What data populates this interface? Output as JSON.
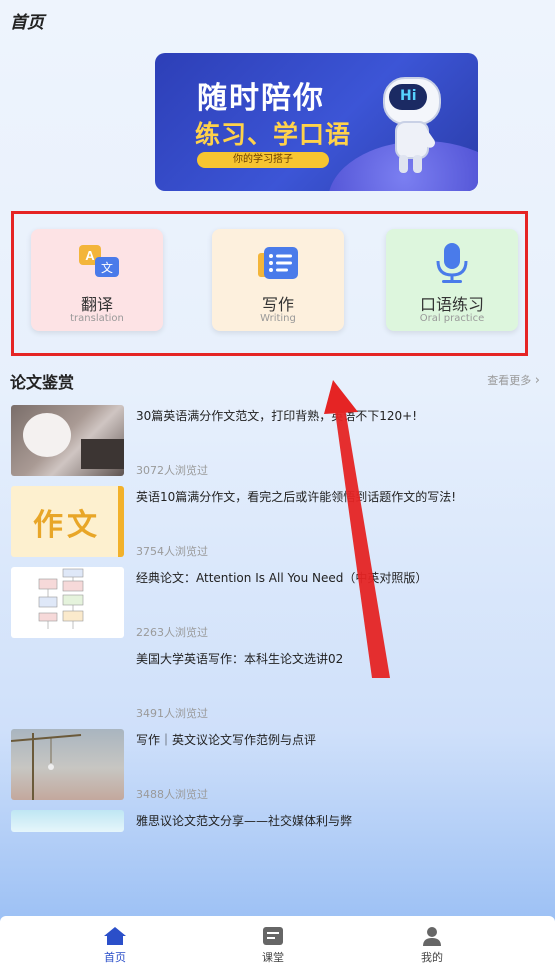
{
  "header": {
    "title": "首页"
  },
  "banner": {
    "line1": "随时陪你",
    "line2": "练习、学口语",
    "tag": "你的学习搭子",
    "robot_text": "Hi"
  },
  "features": [
    {
      "label": "翻译",
      "sub": "translation",
      "icon": "translate-icon"
    },
    {
      "label": "写作",
      "sub": "Writing",
      "icon": "writing-icon"
    },
    {
      "label": "口语练习",
      "sub": "Oral practice",
      "icon": "microphone-icon"
    }
  ],
  "section": {
    "title": "论文鉴赏",
    "more": "查看更多"
  },
  "articles": [
    {
      "title": "30篇英语满分作文范文，打印背熟，英语不下120+!",
      "views": "3072人浏览过"
    },
    {
      "title": "英语10篇满分作文，看完之后或许能领悟到话题作文的写法!",
      "views": "3754人浏览过",
      "thumb_text": "作文"
    },
    {
      "title": "经典论文：Attention Is All You Need（中英对照版）",
      "views": "2263人浏览过"
    },
    {
      "title": "美国大学英语写作：本科生论文选讲02",
      "views": "3491人浏览过"
    },
    {
      "title": "写作｜英文议论文写作范例与点评",
      "views": "3488人浏览过"
    },
    {
      "title": "雅思议论文范文分享——社交媒体利与弊",
      "views": ""
    }
  ],
  "tabbar": [
    {
      "label": "首页",
      "icon": "home-icon",
      "active": true
    },
    {
      "label": "课堂",
      "icon": "classroom-icon",
      "active": false
    },
    {
      "label": "我的",
      "icon": "profile-icon",
      "active": false
    }
  ],
  "colors": {
    "accent": "#2b4fc9",
    "highlight_box": "#e52424"
  }
}
